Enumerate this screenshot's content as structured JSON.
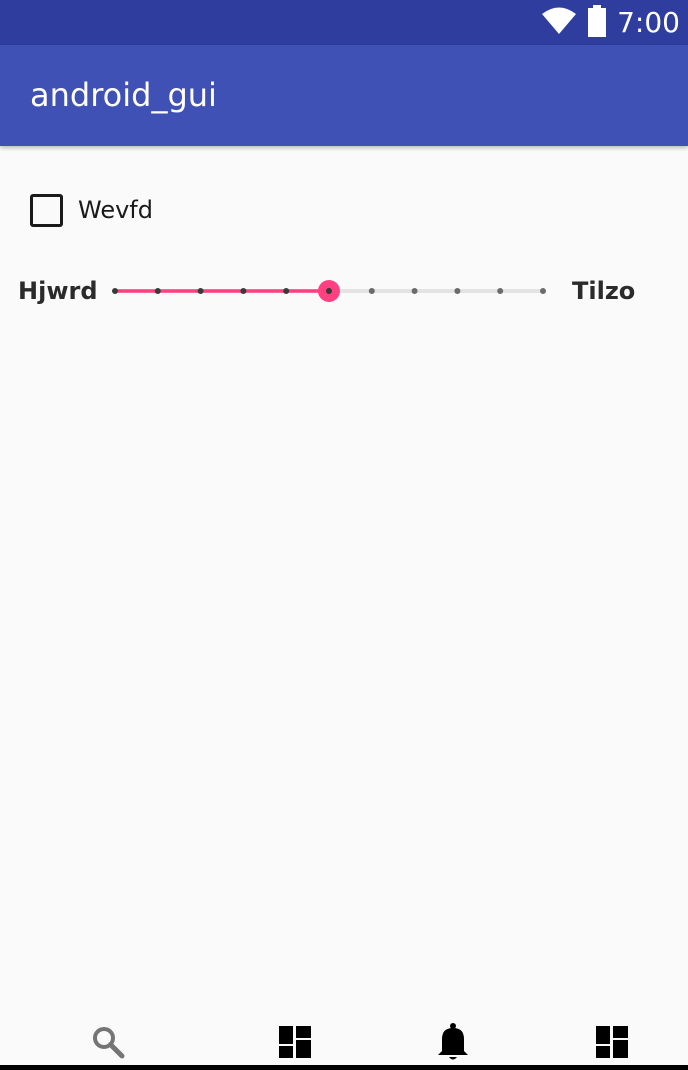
{
  "status_bar": {
    "time": "7:00",
    "icons": [
      "wifi-icon",
      "battery-icon"
    ]
  },
  "app_bar": {
    "title": "android_gui"
  },
  "checkbox": {
    "label": "Wevfd",
    "checked": false
  },
  "slider": {
    "min_label": "Hjwrd",
    "max_label": "Tilzo",
    "steps": 10,
    "value": 5
  },
  "bottom_nav": {
    "items": [
      {
        "icon": "search-icon"
      },
      {
        "icon": "dashboard-icon"
      },
      {
        "icon": "bell-icon"
      },
      {
        "icon": "dashboard-icon"
      }
    ]
  },
  "colors": {
    "status_bar": "#2f3e9e",
    "app_bar": "#3f51b5",
    "accent": "#ff4081",
    "background": "#fafafa"
  }
}
